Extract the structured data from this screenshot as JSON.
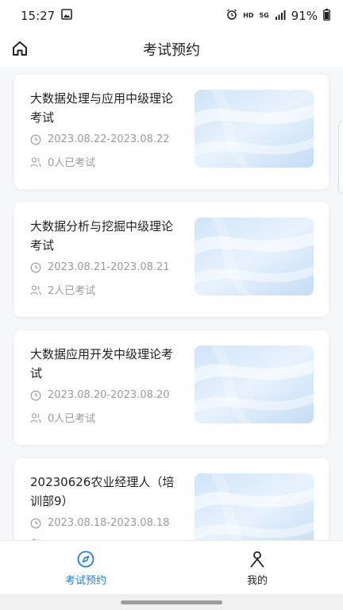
{
  "status": {
    "time": "15:27",
    "hd": "HD",
    "network": "5G",
    "battery": "91%"
  },
  "header": {
    "title": "考试预约"
  },
  "exams": [
    {
      "title": "大数据处理与应用中级理论考试",
      "date": "2023.08.22-2023.08.22",
      "count": "0人已考试"
    },
    {
      "title": "大数据分析与挖掘中级理论考试",
      "date": "2023.08.21-2023.08.21",
      "count": "2人已考试"
    },
    {
      "title": "大数据应用开发中级理论考试",
      "date": "2023.08.20-2023.08.20",
      "count": "0人已考试"
    },
    {
      "title": "20230626农业经理人（培训部9）",
      "date": "2023.08.18-2023.08.18",
      "count": ""
    }
  ],
  "nav": {
    "exam_label": "考试预约",
    "mine_label": "我的"
  },
  "colors": {
    "accent": "#1e7fd6",
    "muted": "#9a9a9a"
  },
  "icons": [
    "image-icon",
    "alarm-icon",
    "signal-icon",
    "battery-icon",
    "home-icon",
    "clock-icon",
    "people-icon",
    "compass-icon",
    "person-icon"
  ]
}
